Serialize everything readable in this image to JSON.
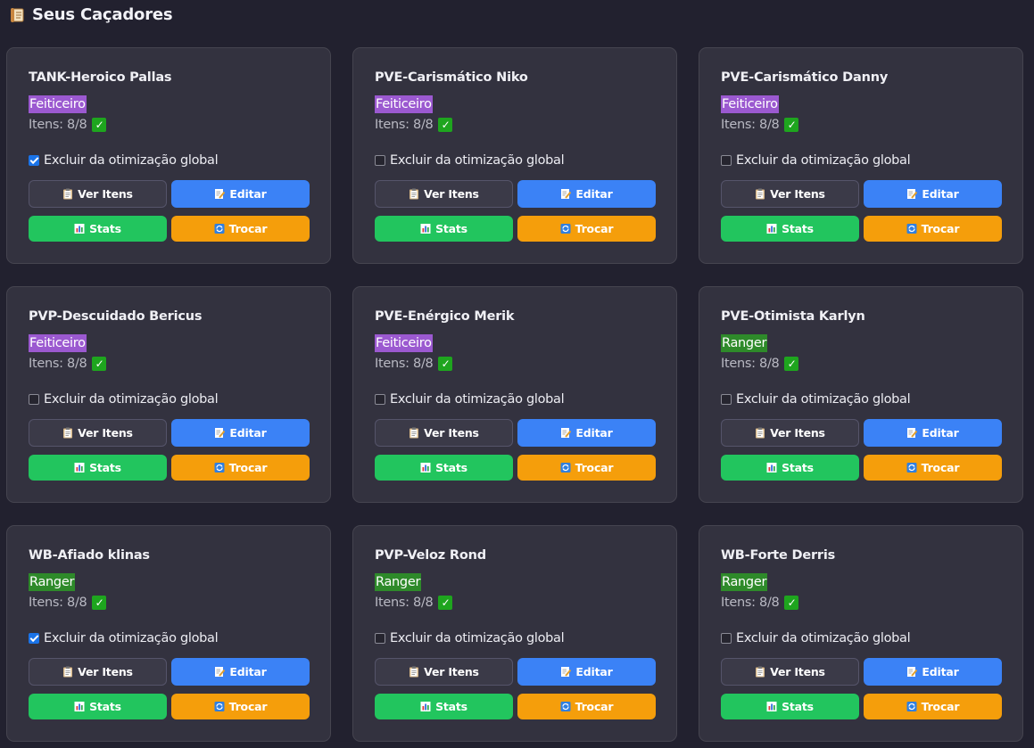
{
  "header": {
    "icon": "scroll-icon",
    "title": "Seus Caçadores"
  },
  "labels": {
    "items_prefix": "Itens: ",
    "exclude": "Excluir da otimização global",
    "view_items": "Ver Itens",
    "edit": "Editar",
    "stats": "Stats",
    "swap": "Trocar"
  },
  "icons": {
    "view_items": "clipboard-icon",
    "edit": "memo-icon",
    "stats": "bar-chart-icon",
    "swap": "refresh-icon",
    "items_ok": "check-mark-icon"
  },
  "colors": {
    "feiticeiro": "#9b59d0",
    "ranger": "#2e8a2a",
    "edit": "#3b82f6",
    "stats": "#22c55e",
    "swap": "#f59e0b"
  },
  "hunters": [
    {
      "name": "TANK-Heroico Pallas",
      "class": "Feiticeiro",
      "items": "8/8",
      "excluded": true
    },
    {
      "name": "PVE-Carismático Niko",
      "class": "Feiticeiro",
      "items": "8/8",
      "excluded": false
    },
    {
      "name": "PVE-Carismático Danny",
      "class": "Feiticeiro",
      "items": "8/8",
      "excluded": false
    },
    {
      "name": "PVP-Descuidado Bericus",
      "class": "Feiticeiro",
      "items": "8/8",
      "excluded": false
    },
    {
      "name": "PVE-Enérgico Merik",
      "class": "Feiticeiro",
      "items": "8/8",
      "excluded": false
    },
    {
      "name": "PVE-Otimista Karlyn",
      "class": "Ranger",
      "items": "8/8",
      "excluded": false
    },
    {
      "name": "WB-Afiado klinas",
      "class": "Ranger",
      "items": "8/8",
      "excluded": true
    },
    {
      "name": "PVP-Veloz Rond",
      "class": "Ranger",
      "items": "8/8",
      "excluded": false
    },
    {
      "name": "WB-Forte Derris",
      "class": "Ranger",
      "items": "8/8",
      "excluded": false
    }
  ]
}
